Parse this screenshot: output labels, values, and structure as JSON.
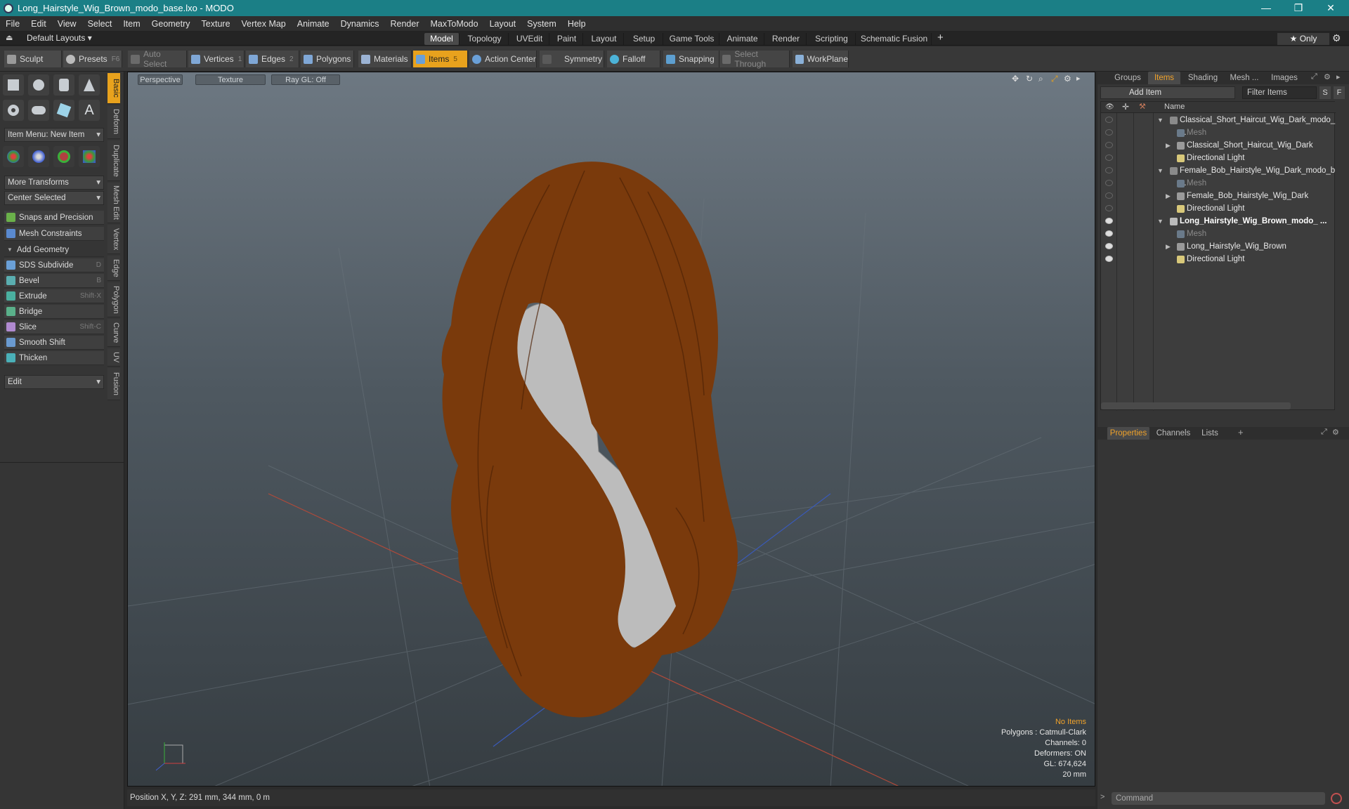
{
  "titlebar": {
    "title": "Long_Hairstyle_Wig_Brown_modo_base.lxo - MODO",
    "minimize": "—",
    "maximize": "❐",
    "close": "✕"
  },
  "menu": [
    "File",
    "Edit",
    "View",
    "Select",
    "Item",
    "Geometry",
    "Texture",
    "Vertex Map",
    "Animate",
    "Dynamics",
    "Render",
    "MaxToModo",
    "Layout",
    "System",
    "Help"
  ],
  "layoutbar": {
    "layouts_label": "Default Layouts ▾",
    "tabs": [
      "Model",
      "Topology",
      "UVEdit",
      "Paint",
      "Layout",
      "Setup",
      "Game Tools",
      "Animate",
      "Render",
      "Scripting",
      "Schematic Fusion"
    ],
    "active_tab": "Model",
    "add": "+",
    "only": "★  Only",
    "gear": "⚙"
  },
  "toolbar": {
    "sculpt": "Sculpt",
    "presets": "Presets",
    "presets_key": "F6",
    "auto_select": "Auto Select",
    "vertices": "Vertices",
    "vertices_key": "1",
    "edges": "Edges",
    "edges_key": "2",
    "polygons": "Polygons",
    "materials": "Materials",
    "items": "Items",
    "items_key": "5",
    "action_center": "Action Center",
    "symmetry": "Symmetry",
    "falloff": "Falloff",
    "snapping": "Snapping",
    "select_through": "Select Through",
    "workplane": "WorkPlane"
  },
  "leftpanel": {
    "item_menu": "Item Menu: New Item",
    "more_transforms": "More Transforms",
    "center_selected": "Center Selected",
    "snaps": "Snaps and Precision",
    "mesh_constraints": "Mesh Constraints",
    "add_geometry": "Add Geometry",
    "tools": [
      {
        "label": "SDS Subdivide",
        "key": "D"
      },
      {
        "label": "Bevel",
        "key": "B"
      },
      {
        "label": "Extrude",
        "key": "Shift-X"
      },
      {
        "label": "Bridge",
        "key": ""
      },
      {
        "label": "Slice",
        "key": "Shift-C"
      },
      {
        "label": "Smooth Shift",
        "key": ""
      },
      {
        "label": "Thicken",
        "key": ""
      }
    ],
    "edit": "Edit"
  },
  "vtabs": [
    "Basic",
    "Deform",
    "Duplicate",
    "Mesh Edit",
    "Vertex",
    "Edge",
    "Polygon",
    "Curve",
    "UV",
    "Fusion"
  ],
  "viewport": {
    "perspective": "Perspective",
    "texture": "Texture",
    "raygl": "Ray GL: Off",
    "info": {
      "no_items": "No Items",
      "polygons": "Polygons : Catmull-Clark",
      "channels": "Channels: 0",
      "deformers": "Deformers: ON",
      "gl": "GL: 674,624",
      "scale": "20 mm"
    }
  },
  "status": {
    "position": "Position X, Y, Z:  291 mm, 344 mm, 0 m"
  },
  "rightpanel": {
    "tabs": [
      "Groups",
      "Items",
      "Shading",
      "Mesh ...",
      "Images"
    ],
    "active_tab": "Items",
    "add_item": "Add Item",
    "filter_items": "Filter Items",
    "s": "S",
    "f": "F",
    "name_col": "Name",
    "items": [
      {
        "label": "Classical_Short_Haircut_Wig_Dark_modo_ ...",
        "depth": 0,
        "style": "scene"
      },
      {
        "label": "Mesh",
        "depth": 1,
        "style": "dim"
      },
      {
        "label": "Classical_Short_Haircut_Wig_Dark",
        "depth": 1,
        "style": "normal"
      },
      {
        "label": "Directional Light",
        "depth": 1,
        "style": "normal"
      },
      {
        "label": "Female_Bob_Hairstyle_Wig_Dark_modo_b ...",
        "depth": 0,
        "style": "scene"
      },
      {
        "label": "Mesh",
        "depth": 1,
        "style": "dim"
      },
      {
        "label": "Female_Bob_Hairstyle_Wig_Dark",
        "depth": 1,
        "style": "normal"
      },
      {
        "label": "Directional Light",
        "depth": 1,
        "style": "normal"
      },
      {
        "label": "Long_Hairstyle_Wig_Brown_modo_ ...",
        "depth": 0,
        "style": "bold"
      },
      {
        "label": "Mesh",
        "depth": 1,
        "style": "dim"
      },
      {
        "label": "Long_Hairstyle_Wig_Brown",
        "depth": 1,
        "style": "normal"
      },
      {
        "label": "Directional Light",
        "depth": 1,
        "style": "normal"
      }
    ],
    "props_tabs": [
      "Properties",
      "Channels",
      "Lists"
    ],
    "props_active": "Properties",
    "command_placeholder": "Command"
  },
  "colors": {
    "accent": "#e8a21d",
    "titlebar": "#1b7f86",
    "hair": "#7a3a0c",
    "head": "#bfbfbf"
  }
}
